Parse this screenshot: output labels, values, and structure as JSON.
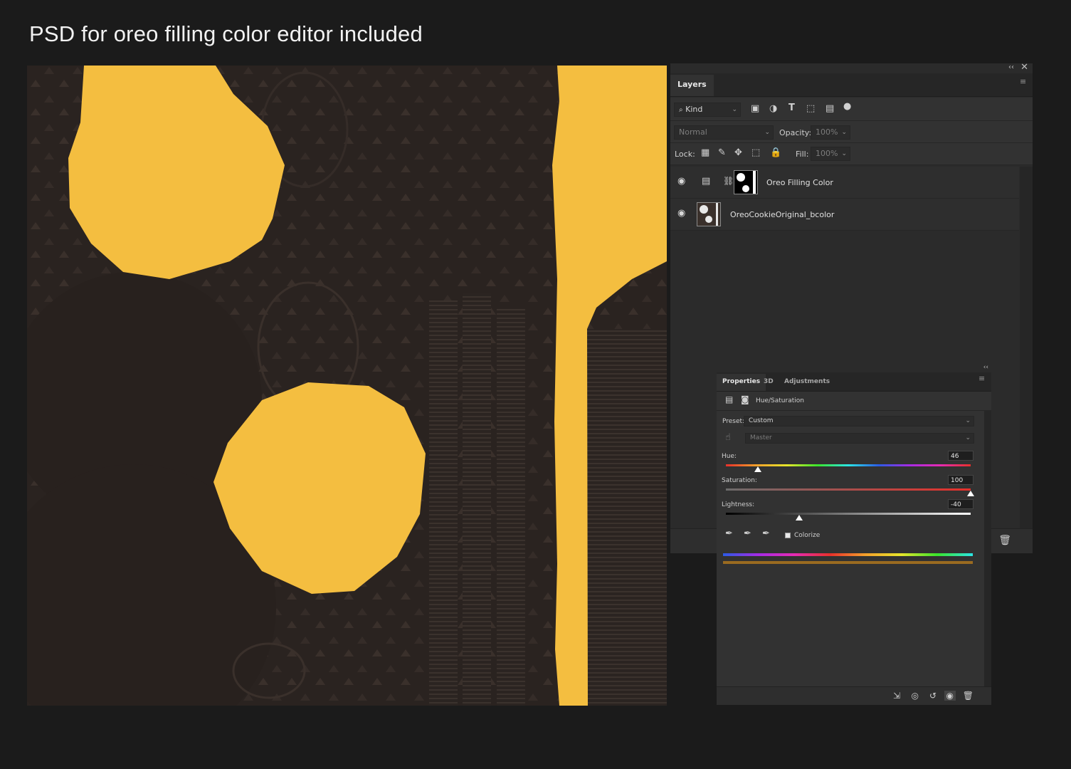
{
  "headline": "PSD for oreo filling color editor included",
  "colors": {
    "filling": "#f4be40",
    "cookie": "#2a2320",
    "panel": "#323232",
    "panel_dark": "#262626"
  },
  "layers_panel": {
    "tab_label": "Layers",
    "filter_kind": "Kind",
    "blend_mode": "Normal",
    "opacity_label": "Opacity:",
    "opacity_value": "100%",
    "lock_label": "Lock:",
    "fill_label": "Fill:",
    "fill_value": "100%",
    "layers": [
      {
        "name": "Oreo Filling Color",
        "visible": true,
        "type": "hue-saturation-adjustment"
      },
      {
        "name": "OreoCookieOriginal_bcolor",
        "visible": true,
        "type": "pixel"
      }
    ]
  },
  "properties_panel": {
    "tabs": [
      "Properties",
      "3D",
      "Adjustments"
    ],
    "active_tab": "Properties",
    "adjustment_name": "Hue/Saturation",
    "preset_label": "Preset:",
    "preset_value": "Custom",
    "channel_value": "Master",
    "hue_label": "Hue:",
    "hue_value": "46",
    "saturation_label": "Saturation:",
    "saturation_value": "100",
    "lightness_label": "Lightness:",
    "lightness_value": "-40",
    "colorize_label": "Colorize",
    "colorize_checked": true,
    "hue_fraction": 0.13,
    "saturation_fraction": 1.0,
    "lightness_fraction": 0.3
  }
}
